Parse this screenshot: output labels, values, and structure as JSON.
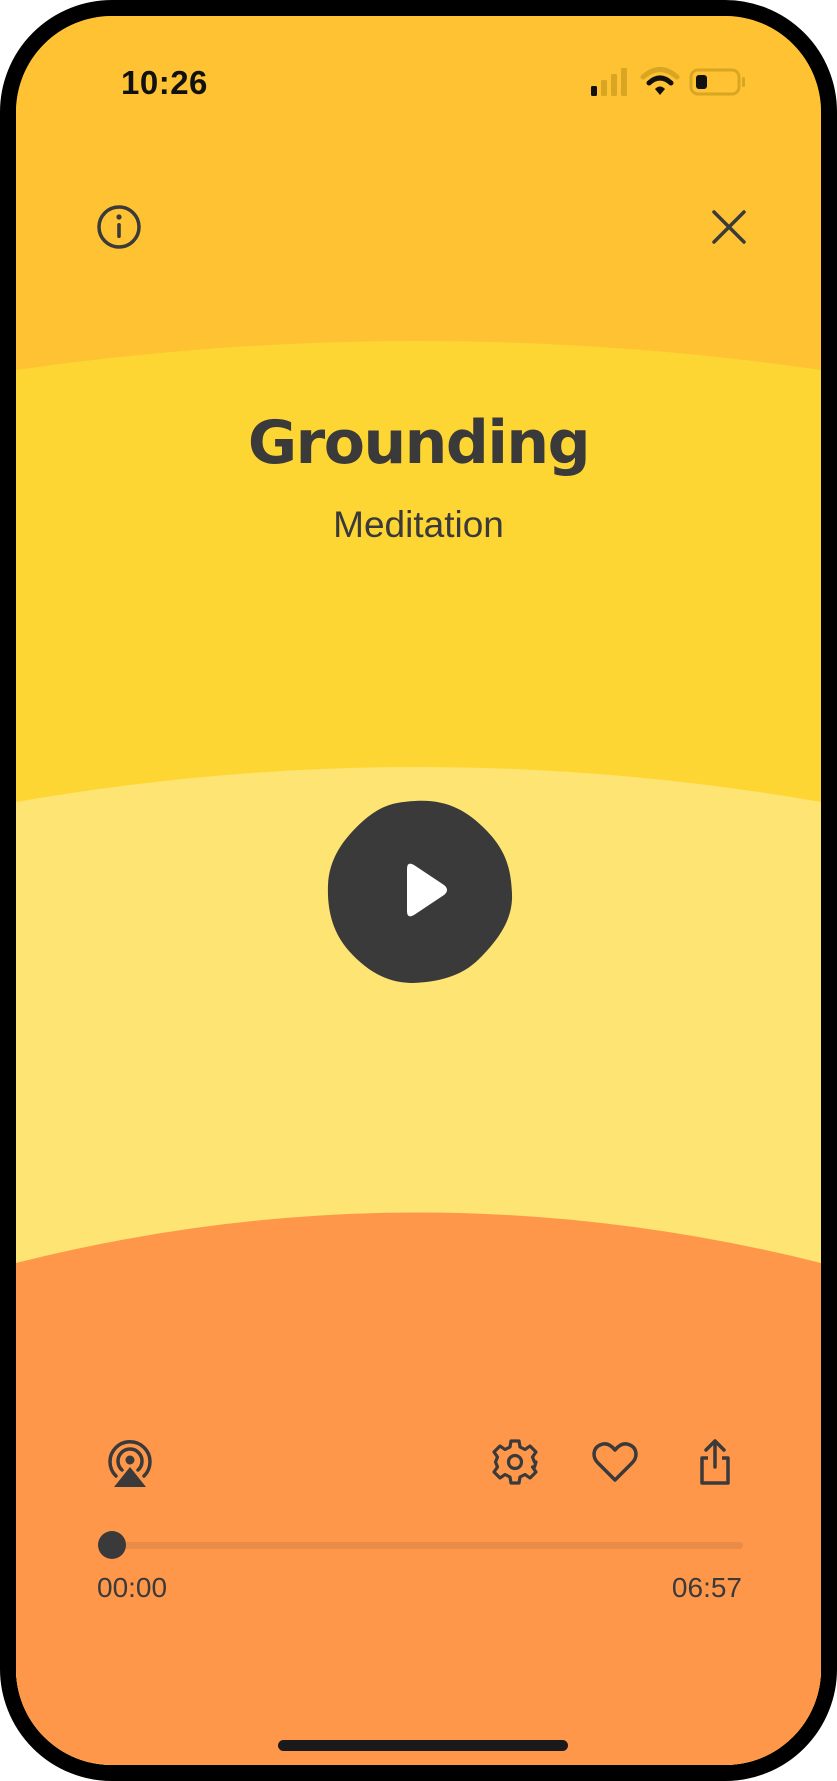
{
  "status_bar": {
    "time": "10:26"
  },
  "header": {
    "info_icon": "info-circle-icon",
    "close_icon": "close-icon"
  },
  "session": {
    "title": "Grounding",
    "subtitle": "Meditation"
  },
  "player": {
    "play_icon": "play-icon",
    "progress_fraction": 0.0,
    "elapsed": "00:00",
    "total": "06:57"
  },
  "controls": {
    "airplay_icon": "airplay-icon",
    "settings_icon": "gear-icon",
    "favorite_icon": "heart-icon",
    "share_icon": "share-icon"
  },
  "colors": {
    "top_band": "#FEC233",
    "title_band": "#FED634",
    "middle_band": "#FEE473",
    "bottom_band": "#FF974B",
    "ink": "#3B3A3A",
    "track": "#E98C48"
  }
}
